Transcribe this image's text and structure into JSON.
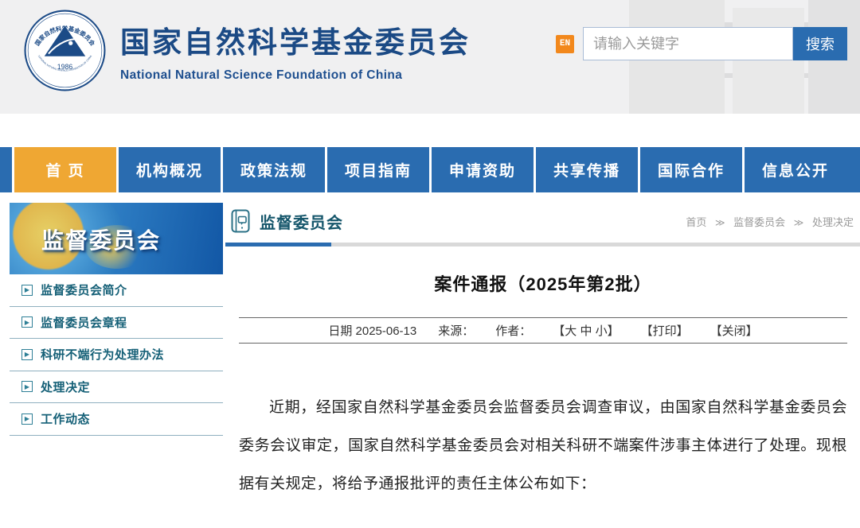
{
  "header": {
    "logo": {
      "ring_text_cn": "国家自然科学基金委员会",
      "ring_text_en": "NATIONAL NATURAL SCIENCE FOUNDATION OF CHINA",
      "year": "1986"
    },
    "title_cn": "国家自然科学基金委员会",
    "title_en": "National Natural Science Foundation of China",
    "en_button": "EN",
    "search": {
      "placeholder": "请输入关键字",
      "button_label": "搜索"
    }
  },
  "nav": {
    "items": [
      {
        "label": "首 页",
        "active": true
      },
      {
        "label": "机构概况",
        "active": false
      },
      {
        "label": "政策法规",
        "active": false
      },
      {
        "label": "项目指南",
        "active": false
      },
      {
        "label": "申请资助",
        "active": false
      },
      {
        "label": "共享传播",
        "active": false
      },
      {
        "label": "国际合作",
        "active": false
      },
      {
        "label": "信息公开",
        "active": false
      }
    ]
  },
  "sidebar": {
    "banner_title": "监督委员会",
    "items": [
      {
        "label": "监督委员会简介"
      },
      {
        "label": "监督委员会章程"
      },
      {
        "label": "科研不端行为处理办法"
      },
      {
        "label": "处理决定"
      },
      {
        "label": "工作动态"
      }
    ]
  },
  "content": {
    "section_title": "监督委员会",
    "breadcrumb": {
      "items": [
        "首页",
        "监督委员会",
        "处理决定"
      ],
      "separator": "≫"
    },
    "article": {
      "title": "案件通报（2025年第2批）",
      "meta": {
        "date": "日期 2025-06-13",
        "source": "来源：",
        "author": "作者：",
        "font_size_control": "【大 中 小】",
        "print": "【打印】",
        "close": "【关闭】"
      },
      "body": "近期，经国家自然科学基金委员会监督委员会调查审议，由国家自然科学基金委员会委务会议审定，国家自然科学基金委员会对相关科研不端案件涉事主体进行了处理。现根据有关规定，将给予通报批评的责任主体公布如下："
    }
  },
  "colors": {
    "nav_blue": "#2a6cb0",
    "active_tab_orange": "#efa733",
    "en_badge_orange": "#f2881c",
    "brand_navy": "#1b4a85",
    "teal_text": "#156077"
  }
}
